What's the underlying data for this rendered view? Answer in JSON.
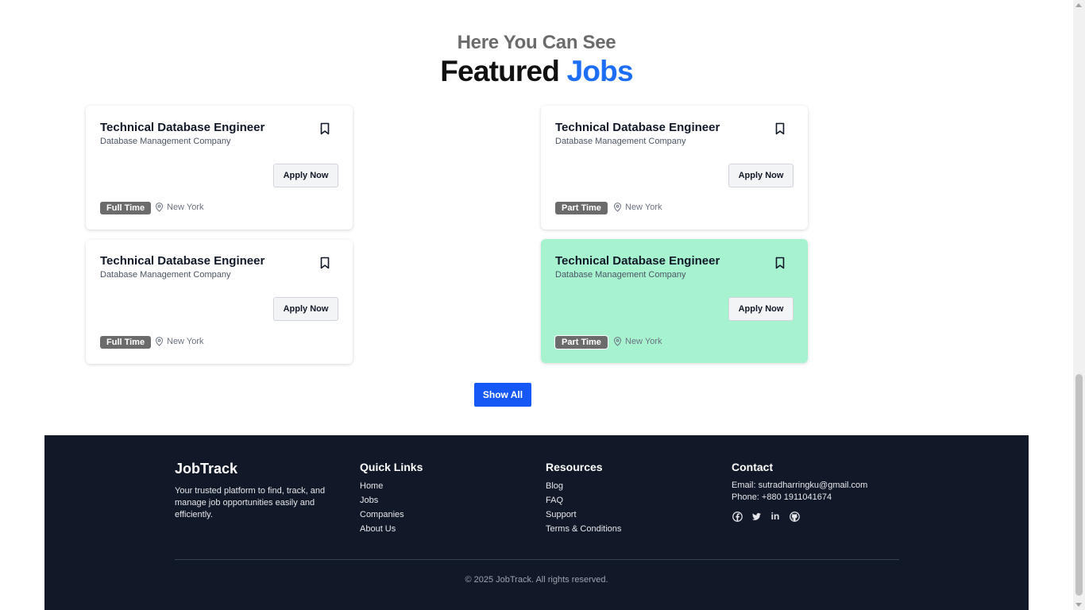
{
  "section": {
    "subheading": "Here You Can See",
    "heading_main": "Featured",
    "heading_accent": "Jobs"
  },
  "jobs": [
    {
      "title": "Technical Database Engineer",
      "company": "Database Management Company",
      "apply_label": "Apply Now",
      "type": "Full Time",
      "location": "New York",
      "highlighted": false
    },
    {
      "title": "Technical Database Engineer",
      "company": "Database Management Company",
      "apply_label": "Apply Now",
      "type": "Part Time",
      "location": "New York",
      "highlighted": false
    },
    {
      "title": "Technical Database Engineer",
      "company": "Database Management Company",
      "apply_label": "Apply Now",
      "type": "Full Time",
      "location": "New York",
      "highlighted": false
    },
    {
      "title": "Technical Database Engineer",
      "company": "Database Management Company",
      "apply_label": "Apply Now",
      "type": "Part Time",
      "location": "New York",
      "highlighted": true
    }
  ],
  "show_all_label": "Show All",
  "footer": {
    "brand": "JobTrack",
    "tagline": "Your trusted platform to find, track, and manage job opportunities easily and efficiently.",
    "quick_links": {
      "title": "Quick Links",
      "items": [
        "Home",
        "Jobs",
        "Companies",
        "About Us"
      ]
    },
    "resources": {
      "title": "Resources",
      "items": [
        "Blog",
        "FAQ",
        "Support",
        "Terms & Conditions"
      ]
    },
    "contact": {
      "title": "Contact",
      "email": "Email: sutradharringku@gmail.com",
      "phone": "Phone: +880 1911041674",
      "socials": [
        "facebook-icon",
        "twitter-icon",
        "linkedin-icon",
        "github-icon"
      ]
    },
    "copyright": "© 2025 JobTrack. All rights reserved."
  },
  "colors": {
    "accent": "#1d6ef5",
    "button_primary": "#1558f5",
    "highlight_card": "#a7f3d0",
    "footer_bg": "#111827",
    "badge_bg": "#6b6b6b"
  }
}
